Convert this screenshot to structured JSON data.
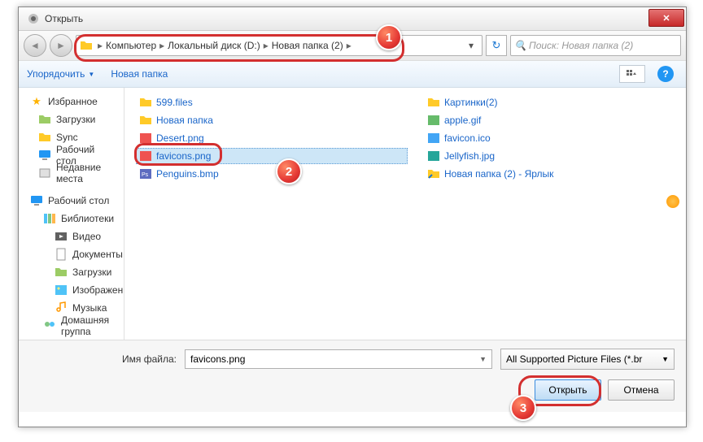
{
  "window": {
    "title": "Открыть"
  },
  "breadcrumb": {
    "seg1": "Компьютер",
    "seg2": "Локальный диск (D:)",
    "seg3": "Новая папка (2)"
  },
  "search": {
    "placeholder": "Поиск: Новая папка (2)"
  },
  "toolbar": {
    "organize": "Упорядочить",
    "newfolder": "Новая папка"
  },
  "sidebar": {
    "favorites": "Избранное",
    "downloads": "Загрузки",
    "sync": "Sync",
    "desktop": "Рабочий стол",
    "recent": "Недавние места",
    "desktop2": "Рабочий стол",
    "libraries": "Библиотеки",
    "videos": "Видео",
    "documents": "Документы",
    "downloads2": "Загрузки",
    "pictures": "Изображения",
    "music": "Музыка",
    "homegroup": "Домашняя группа"
  },
  "files": {
    "c1": {
      "f1": "599.files",
      "f2": "Новая папка",
      "f3": "Desert.png",
      "f4": "favicons.png",
      "f5": "Penguins.bmp"
    },
    "c2": {
      "f1": "Картинки(2)",
      "f2": "apple.gif",
      "f3": "favicon.ico",
      "f4": "Jellyfish.jpg",
      "f5": "Новая папка (2) - Ярлык"
    }
  },
  "bottom": {
    "label": "Имя файла:",
    "value": "favicons.png",
    "filter": "All Supported Picture Files (*.br",
    "open": "Открыть",
    "cancel": "Отмена"
  },
  "markers": {
    "m1": "1",
    "m2": "2",
    "m3": "3"
  }
}
